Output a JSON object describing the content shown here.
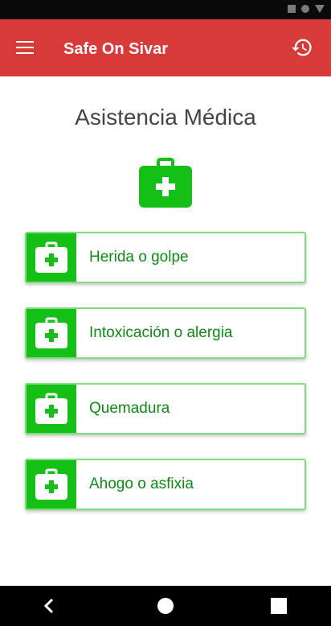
{
  "app": {
    "title": "Safe On Sivar"
  },
  "page": {
    "title": "Asistencia Médica"
  },
  "options": [
    {
      "label": "Herida o golpe",
      "icon": "first-aid-kit-icon"
    },
    {
      "label": "Intoxicación o alergia",
      "icon": "first-aid-kit-icon"
    },
    {
      "label": "Quemadura",
      "icon": "first-aid-kit-icon"
    },
    {
      "label": "Ahogo o asfixia",
      "icon": "first-aid-kit-icon"
    }
  ],
  "colors": {
    "app_bar": "#d83a3a",
    "accent_green": "#14c016",
    "label_green": "#0f8a14",
    "border_green": "#7ee07a"
  },
  "icons": {
    "menu": "hamburger-menu-icon",
    "history": "history-icon",
    "hero": "first-aid-kit-icon"
  }
}
